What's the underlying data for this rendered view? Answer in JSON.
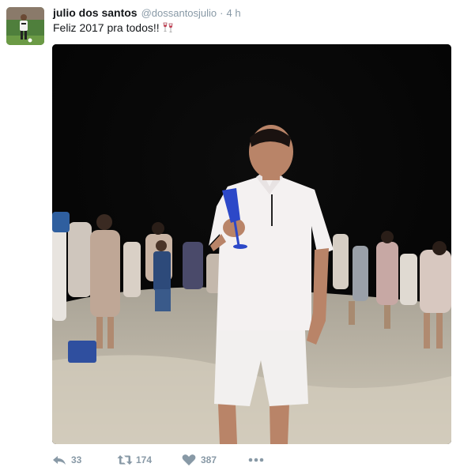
{
  "tweet": {
    "author": {
      "fullname": "julio dos santos",
      "screen_name": "@dossantosjulio"
    },
    "separator": "·",
    "timestamp": "4 h",
    "text": "Feliz 2017 pra todos!!",
    "emoji": "wine-glasses-icon",
    "media": {
      "description_icon": "photo",
      "type": "photo"
    },
    "actions": {
      "reply_count": "33",
      "retweet_count": "174",
      "like_count": "387"
    }
  },
  "colors": {
    "name": "#14171a",
    "meta": "#8899a6",
    "action": "#8899a6",
    "background": "#ffffff"
  }
}
